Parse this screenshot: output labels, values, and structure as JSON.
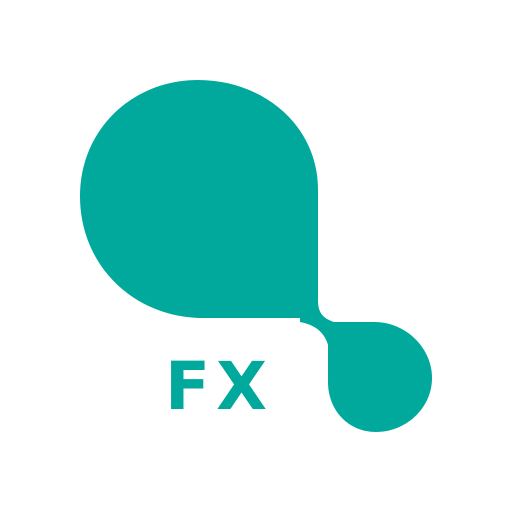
{
  "logo": {
    "text": "FX",
    "color": "#00a99c",
    "icon": "droplet-logo-icon"
  },
  "background": "#ffffff"
}
